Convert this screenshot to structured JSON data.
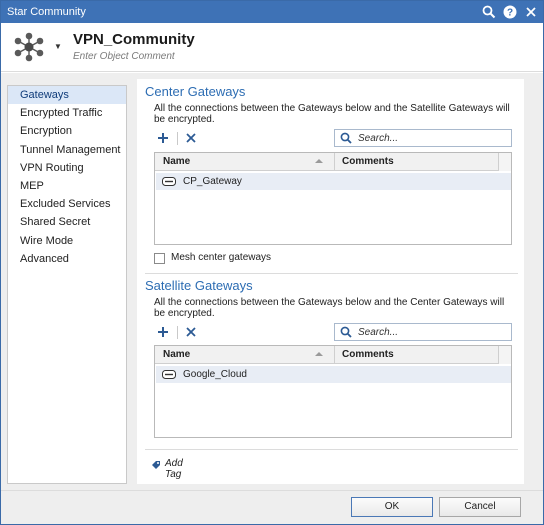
{
  "window": {
    "title": "Star Community",
    "icons": [
      "search-icon",
      "help-icon",
      "close-icon"
    ]
  },
  "object": {
    "icon": "star-community-icon",
    "name": "VPN_Community",
    "comment_placeholder": "Enter Object Comment"
  },
  "sidebar": {
    "items": [
      {
        "label": "Gateways",
        "active": true
      },
      {
        "label": "Encrypted Traffic",
        "active": false
      },
      {
        "label": "Encryption",
        "active": false
      },
      {
        "label": "Tunnel Management",
        "active": false
      },
      {
        "label": "VPN Routing",
        "active": false
      },
      {
        "label": "MEP",
        "active": false
      },
      {
        "label": "Excluded Services",
        "active": false
      },
      {
        "label": "Shared Secret",
        "active": false
      },
      {
        "label": "Wire Mode",
        "active": false
      },
      {
        "label": "Advanced",
        "active": false
      }
    ]
  },
  "center": {
    "title": "Center Gateways",
    "description": "All the connections between the Gateways below and the Satellite Gateways will be encrypted.",
    "search_placeholder": "Search...",
    "columns": [
      "Name",
      "Comments"
    ],
    "rows": [
      {
        "name": "CP_Gateway",
        "comments": ""
      }
    ],
    "mesh_label": "Mesh center gateways",
    "mesh_checked": false
  },
  "satellite": {
    "title": "Satellite Gateways",
    "description": "All the connections between the Gateways below and the Center Gateways will be encrypted.",
    "search_placeholder": "Search...",
    "columns": [
      "Name",
      "Comments"
    ],
    "rows": [
      {
        "name": "Google_Cloud",
        "comments": ""
      }
    ]
  },
  "tags": {
    "add_label": "Add Tag"
  },
  "footer": {
    "ok_label": "OK",
    "cancel_label": "Cancel"
  },
  "colors": {
    "accent": "#3e72b6",
    "section_title": "#2d6db3",
    "selected_row": "#e8edf5"
  }
}
